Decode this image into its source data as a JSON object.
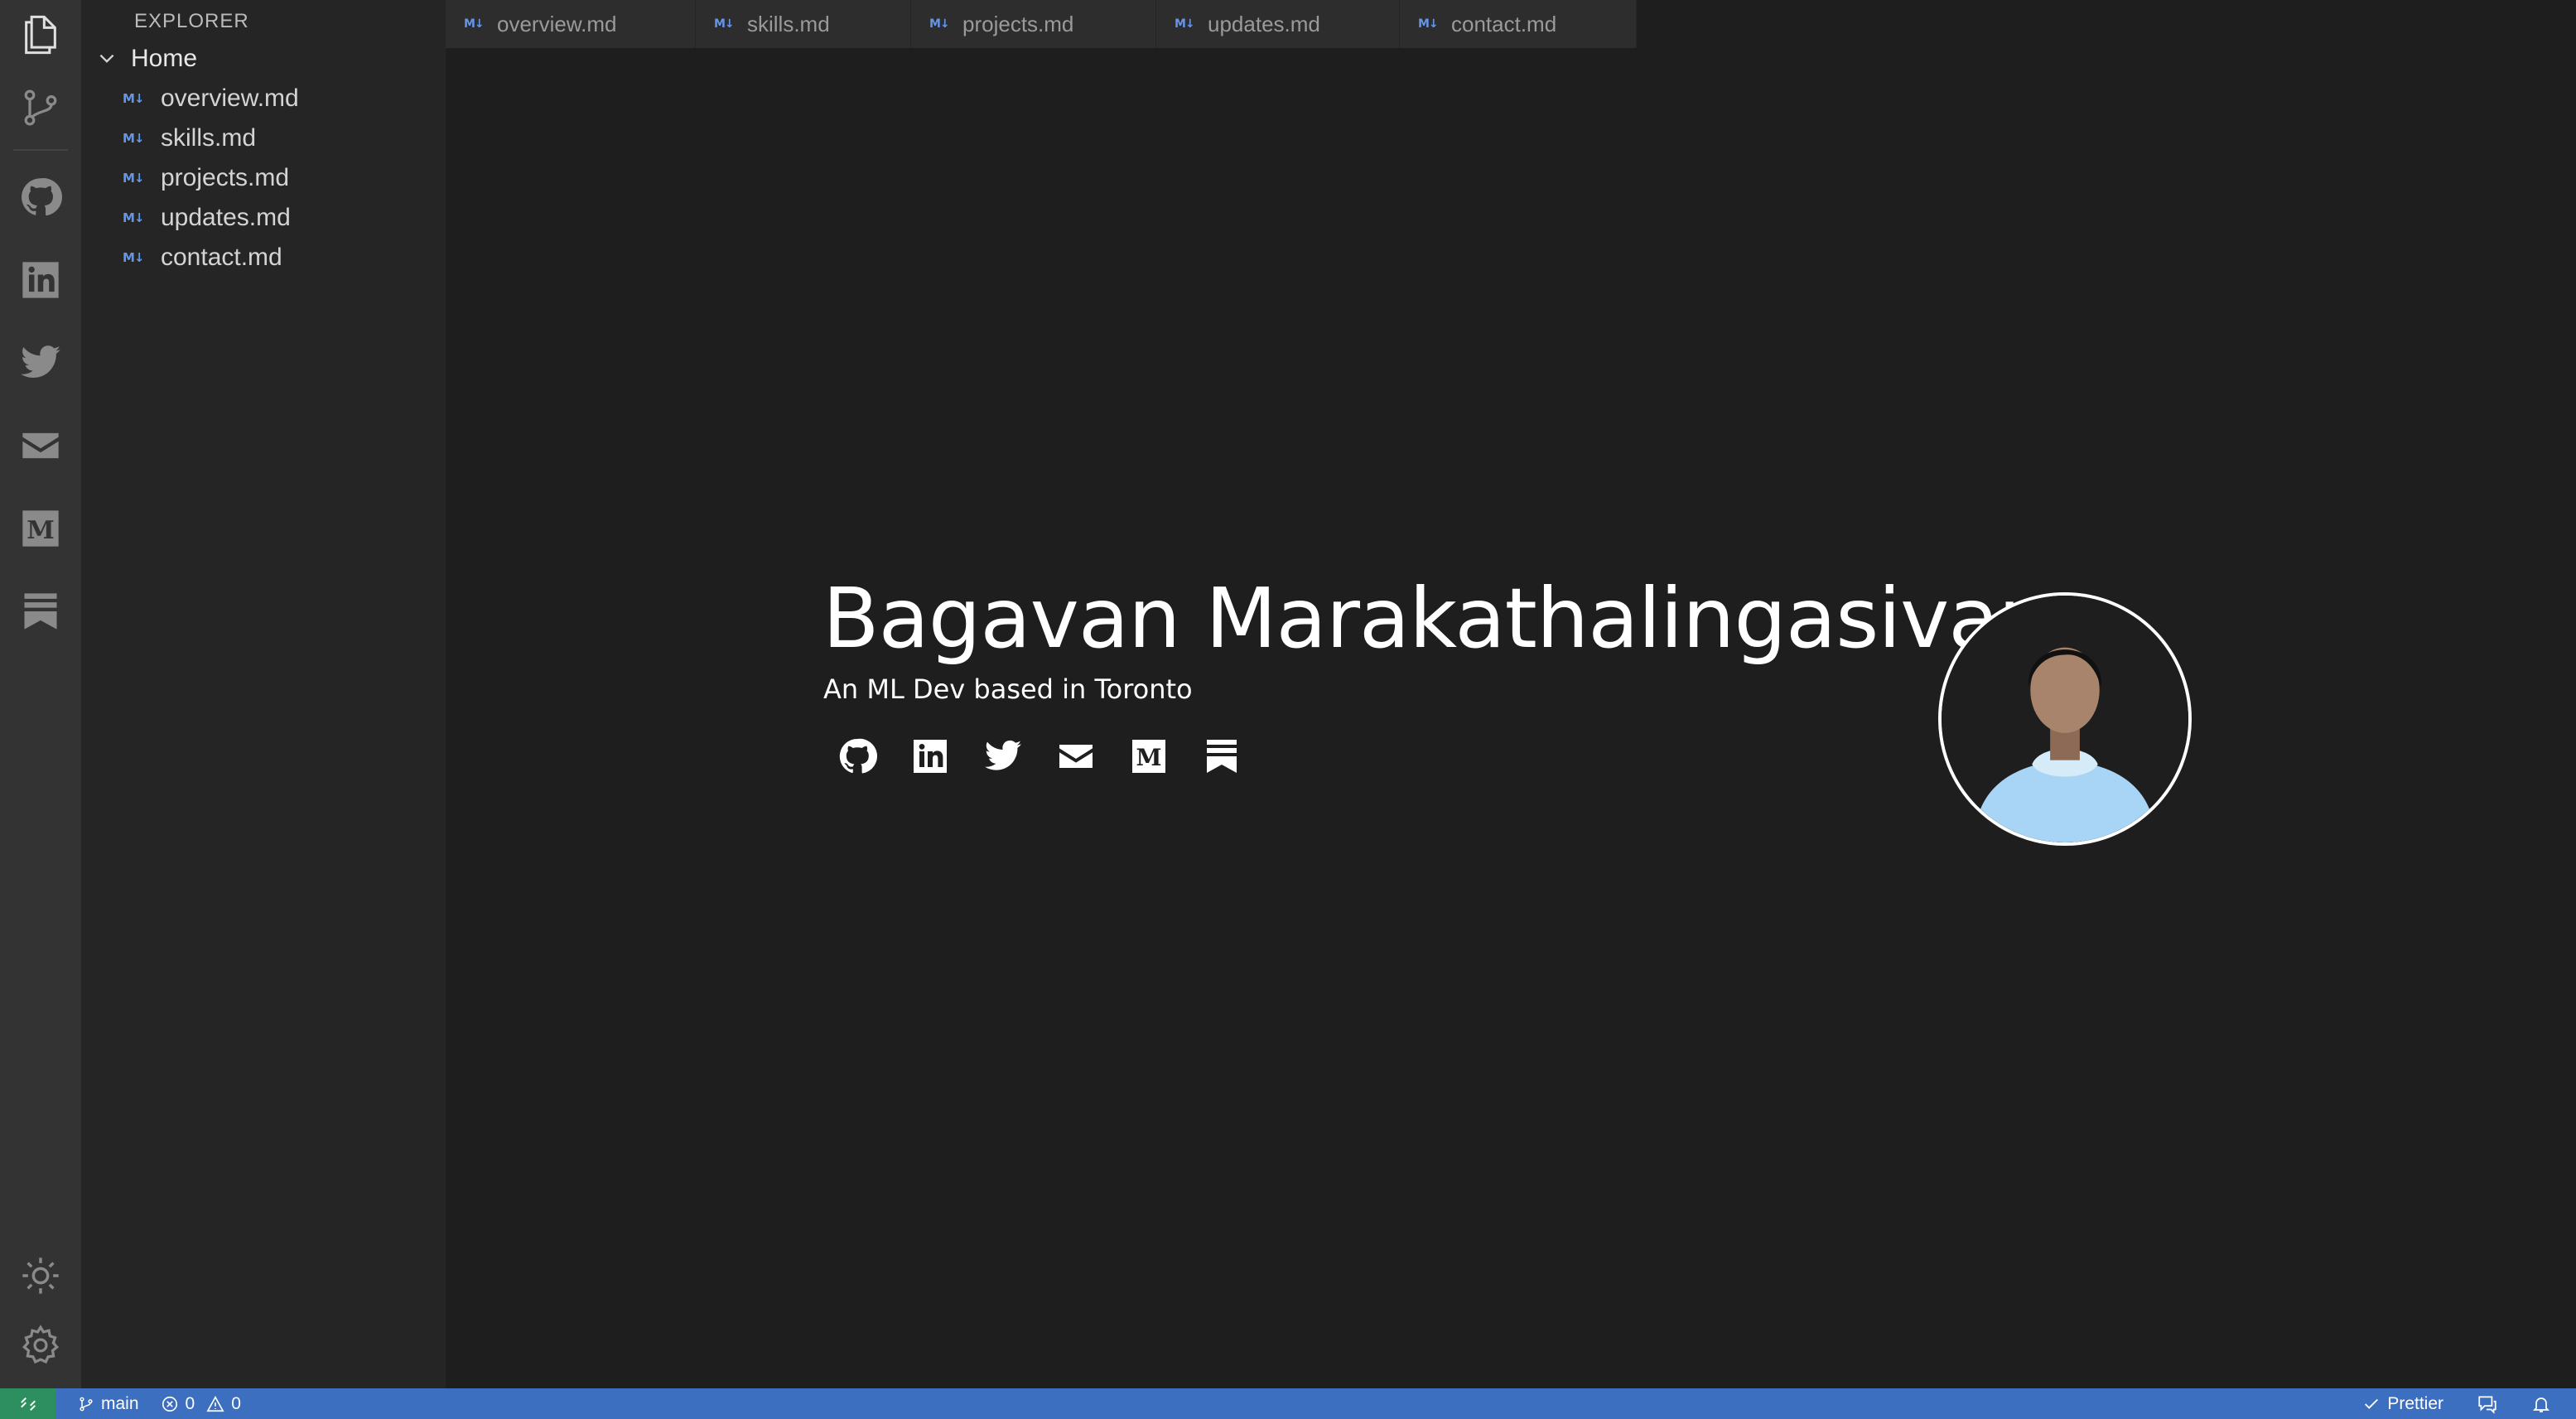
{
  "activity_bar": {
    "icons": [
      "files-icon",
      "source-control-icon",
      "github-icon",
      "linkedin-icon",
      "twitter-icon",
      "mail-icon",
      "medium-icon",
      "substack-icon",
      "theme-toggle-icon",
      "settings-icon"
    ]
  },
  "sidebar": {
    "title": "EXPLORER",
    "root_label": "Home",
    "badge": "M↓",
    "files": [
      "overview.md",
      "skills.md",
      "projects.md",
      "updates.md",
      "contact.md"
    ]
  },
  "tabs": [
    "overview.md",
    "skills.md",
    "projects.md",
    "updates.md",
    "contact.md"
  ],
  "hero": {
    "name": "Bagavan Marakathalingasivam",
    "subtitle": "An ML Dev based in Toronto",
    "social_icons": [
      "github-icon",
      "linkedin-icon",
      "twitter-icon",
      "mail-icon",
      "medium-icon",
      "substack-icon"
    ]
  },
  "status_bar": {
    "branch": "main",
    "errors": "0",
    "warnings": "0",
    "formatter": "Prettier"
  },
  "colors": {
    "activity_bar": "#333333",
    "sidebar": "#252526",
    "editor": "#1e1e1e",
    "status_bar": "#3c6fbf",
    "remote": "#2d8f5f",
    "md_badge": "#6796e6",
    "avatar_hoodie": "#a8d4f5"
  }
}
